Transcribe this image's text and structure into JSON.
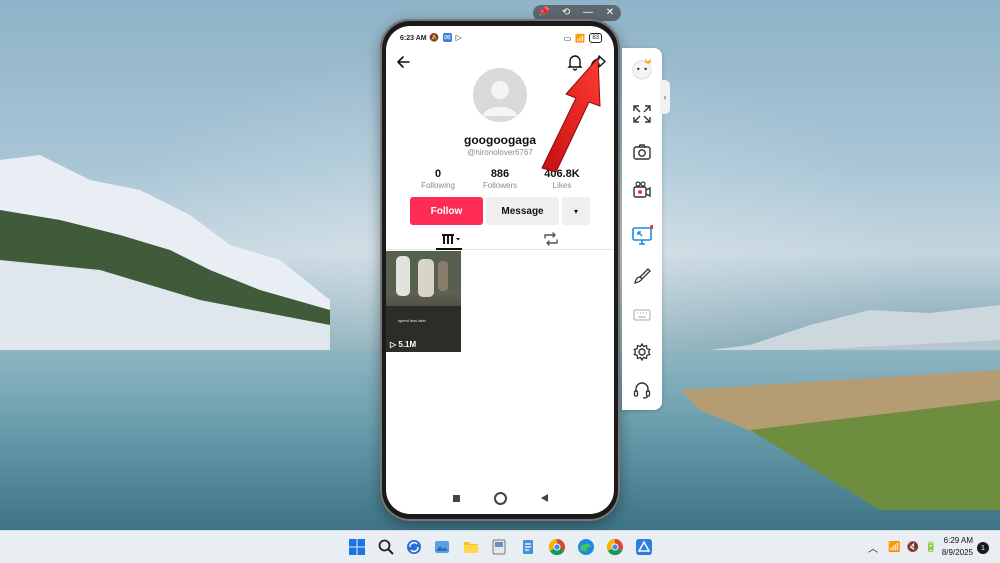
{
  "phone_toolbar": {
    "pin_icon": "pin-icon",
    "rotate_icon": "rotate-icon",
    "minimize_label": "—",
    "close_label": "✕"
  },
  "status_bar": {
    "time": "6:23 AM",
    "battery": "83"
  },
  "profile": {
    "username": "googoogaga",
    "handle": "@hironolover6767",
    "stats": [
      {
        "value": "0",
        "label": "Following"
      },
      {
        "value": "886",
        "label": "Followers"
      },
      {
        "value": "406.8K",
        "label": "Likes"
      }
    ],
    "follow_label": "Follow",
    "message_label": "Message",
    "more_label": "▾"
  },
  "videos": [
    {
      "views": "5.1M",
      "caption": "spend less later"
    }
  ],
  "side_tools": [
    {
      "name": "mascot-icon"
    },
    {
      "name": "fullscreen-icon"
    },
    {
      "name": "screenshot-icon"
    },
    {
      "name": "record-icon"
    },
    {
      "name": "screen-cast-icon"
    },
    {
      "name": "brush-icon"
    },
    {
      "name": "keyboard-icon"
    },
    {
      "name": "settings-icon"
    },
    {
      "name": "support-icon"
    }
  ],
  "taskbar": {
    "time": "6:29 AM",
    "date": "8/9/2025",
    "notification_count": "1"
  },
  "colors": {
    "follow": "#fe2c55",
    "arrow": "#e8141b"
  }
}
